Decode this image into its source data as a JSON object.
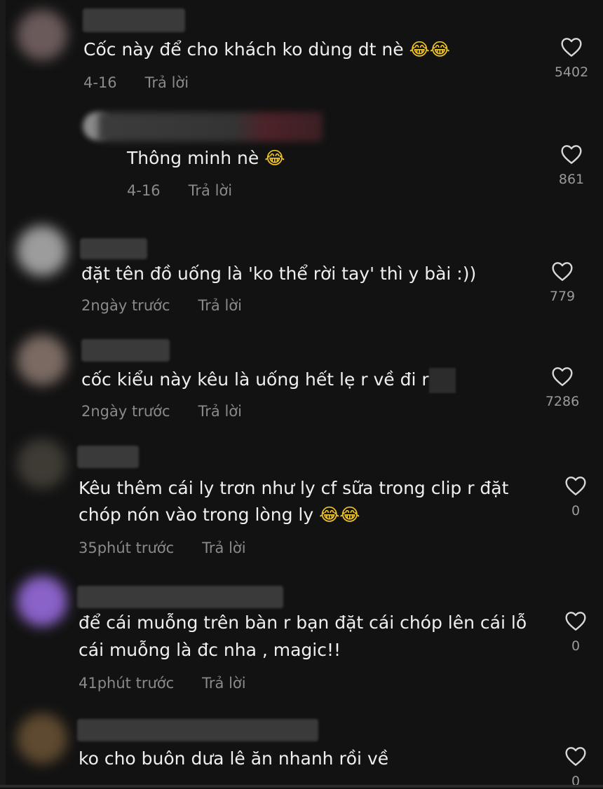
{
  "comments": [
    {
      "text": "Cốc này để cho khách ko dùng dt nè",
      "emoji": "😂😂",
      "time": "4-16",
      "reply": "Trả lời",
      "likes": "5402"
    },
    {
      "text": "Thông minh nè",
      "emoji": "😂",
      "time": "4-16",
      "reply": "Trả lời",
      "likes": "861"
    },
    {
      "text": "đặt tên đồ uống là 'ko thể rời tay' thì y bài :))",
      "time": "2ngày trước",
      "reply": "Trả lời",
      "likes": "779"
    },
    {
      "text": "cốc kiểu này kêu là uống hết lẹ r về đi r",
      "time": "2ngày trước",
      "reply": "Trả lời",
      "likes": "7286"
    },
    {
      "line1": "Kêu thêm cái ly trơn như ly cf sữa trong clip r đặt",
      "line2": "chóp nón vào trong lòng ly",
      "emoji": "😂😂",
      "time": "35phút trước",
      "reply": "Trả lời",
      "likes": "0"
    },
    {
      "line1": "để cái muỗng trên bàn r bạn đặt cái chóp lên cái lỗ",
      "line2": "cái muỗng là đc nha , magic!!",
      "time": "41phút trước",
      "reply": "Trả lời",
      "likes": "0"
    },
    {
      "text": "ko cho buôn dưa lê ăn nhanh rồi về",
      "likes": "0"
    }
  ],
  "icons": {
    "like": "heart-outline-icon"
  },
  "colors": {
    "background": "#121212",
    "text": "#efefef",
    "meta": "#8a8a8a"
  }
}
